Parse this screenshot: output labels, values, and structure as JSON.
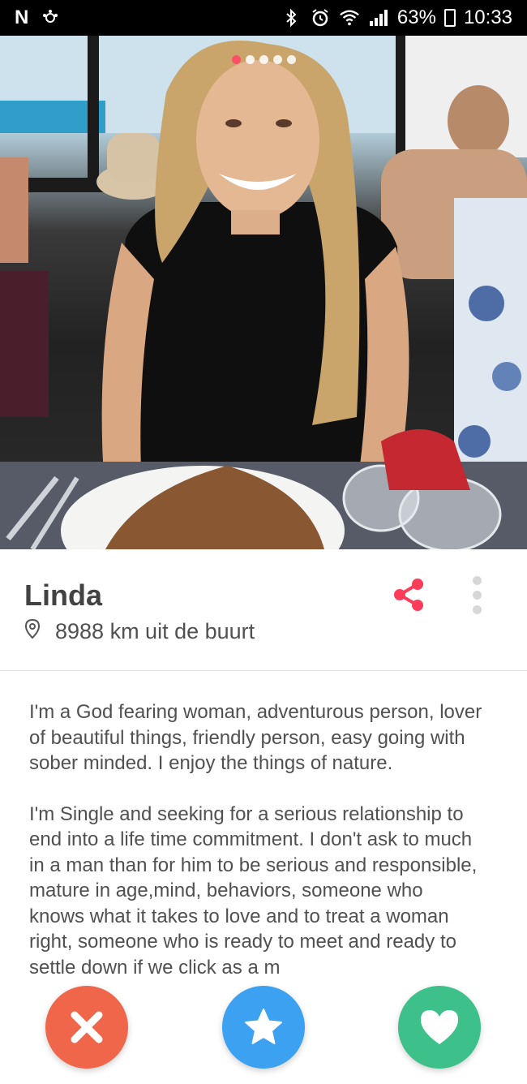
{
  "status_bar": {
    "carrier_icon": "N",
    "battery_percent": "63%",
    "time": "10:33",
    "icons": [
      "bluetooth-icon",
      "alarm-icon",
      "wifi-icon",
      "signal-icon",
      "battery-icon"
    ]
  },
  "photo": {
    "page_count": 5,
    "active_page": 1,
    "accent_color": "#fd5068"
  },
  "profile": {
    "name": "Linda",
    "distance": "8988 km uit de buurt"
  },
  "bio": {
    "paragraph_1": "I'm a God fearing woman, adventurous person, lover of beautiful things, friendly person, easy going with sober minded. I enjoy the things of nature.",
    "paragraph_2": "I'm Single and seeking for a serious relationship to end into a life time commitment. I don't ask to much in a man than for him to be serious and responsible, mature in age,mind, behaviors, someone who knows what it takes to love and to treat a woman right, someone who is ready to meet and ready to settle down if we click as a m"
  },
  "actions": {
    "nope_color": "#f0664b",
    "super_like_color": "#3ba1f0",
    "like_color": "#3ec08a"
  }
}
